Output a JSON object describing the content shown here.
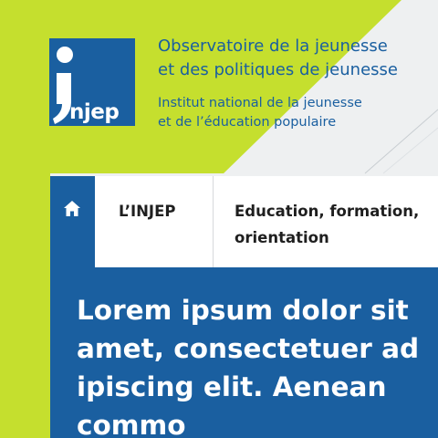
{
  "colors": {
    "brand_blue": "#1a5fa0",
    "lime": "#c5df2e",
    "background": "#eef0f1",
    "nav_text": "#1f1f1f"
  },
  "logo": {
    "word": "njep"
  },
  "header": {
    "title_lines": [
      "Observatoire de la jeunesse",
      "et des politiques de jeunesse"
    ],
    "subtitle_lines": [
      "Institut national de la jeunesse",
      "et de l’éducation populaire"
    ]
  },
  "nav": {
    "home_icon": "home-icon",
    "items": [
      {
        "label_lines": [
          "L’INJEP"
        ]
      },
      {
        "label_lines": [
          "Education, formation,",
          "orientation"
        ]
      }
    ]
  },
  "hero": {
    "headline_lines": [
      "Lorem ipsum dolor sit",
      "amet, consectetuer ad",
      "ipiscing elit. Aenean",
      "commo"
    ]
  }
}
